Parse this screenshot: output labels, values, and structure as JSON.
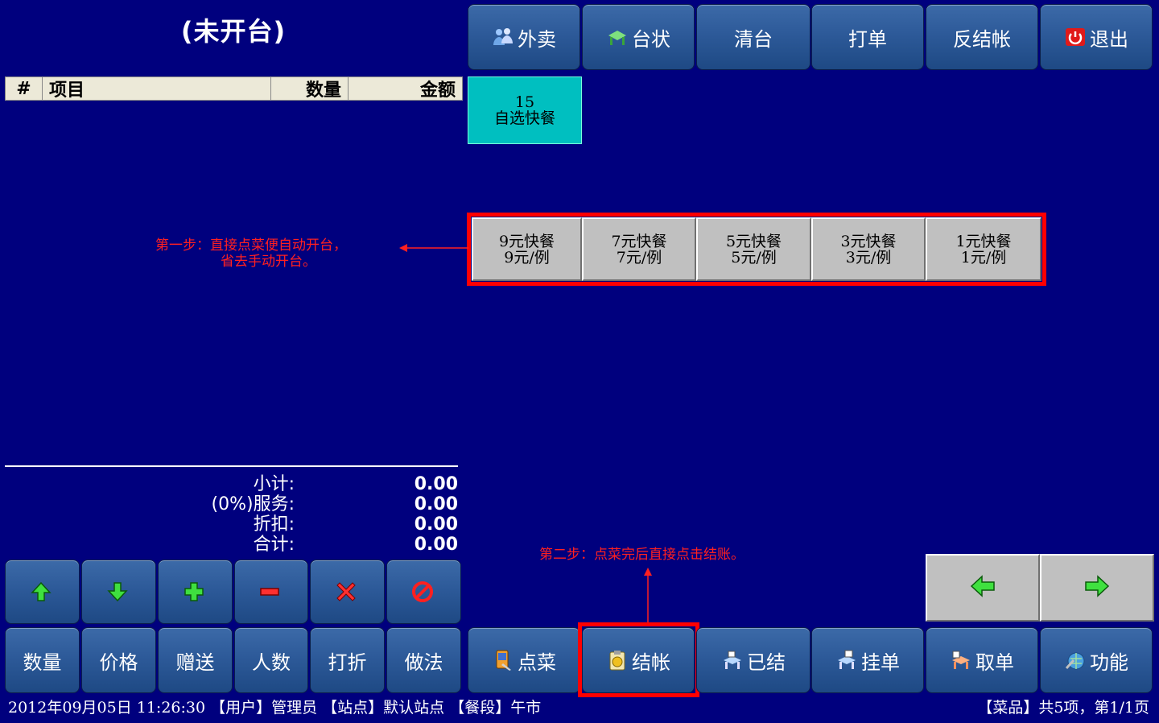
{
  "title": "(未开台)",
  "order_table": {
    "headers": [
      "#",
      "项目",
      "数量",
      "金额"
    ]
  },
  "summary": {
    "subtotal_label": "小计:",
    "subtotal_value": "0.00",
    "service_label": "(0%)服务:",
    "service_value": "0.00",
    "discount_label": "折扣:",
    "discount_value": "0.00",
    "total_label": "合计:",
    "total_value": "0.00"
  },
  "top_buttons": [
    "外卖",
    "台状",
    "清台",
    "打单",
    "反结帐",
    "退出"
  ],
  "category": {
    "count": "15",
    "name": "自选快餐"
  },
  "dishes": [
    {
      "name": "9元快餐",
      "price": "9元/例"
    },
    {
      "name": "7元快餐",
      "price": "7元/例"
    },
    {
      "name": "5元快餐",
      "price": "5元/例"
    },
    {
      "name": "3元快餐",
      "price": "3元/例"
    },
    {
      "name": "1元快餐",
      "price": "1元/例"
    }
  ],
  "annotations": {
    "step1_line1": "第一步：直接点菜便自动开台，",
    "step1_line2": "省去手动开台。",
    "step2": "第二步：点菜完后直接点击结账。"
  },
  "bottom_left_buttons": [
    "数量",
    "价格",
    "赠送",
    "人数",
    "打折",
    "做法"
  ],
  "bottom_right_buttons": [
    "点菜",
    "结帐",
    "已结",
    "挂单",
    "取单",
    "功能"
  ],
  "status": {
    "left": "2012年09月05日 11:26:30 【用户】管理员 【站点】默认站点 【餐段】午市",
    "right": "【菜品】共5项，第1/1页"
  },
  "colors": {
    "background": "#00007e",
    "highlight": "#ff0000",
    "category": "#00bfc0"
  }
}
